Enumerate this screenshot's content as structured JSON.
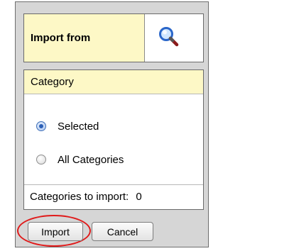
{
  "import": {
    "label": "Import from",
    "lookup_icon": "search-magnifier-icon"
  },
  "category": {
    "header": "Category",
    "options": [
      {
        "label": "Selected",
        "checked": true
      },
      {
        "label": "All Categories",
        "checked": false
      }
    ],
    "count_label": "Categories to import:",
    "count_value": "0"
  },
  "buttons": {
    "import": "Import",
    "cancel": "Cancel"
  },
  "colors": {
    "header_bg": "#fdf8c6",
    "highlight": "#e01a1a",
    "dialog_bg": "#d6d6d6"
  }
}
